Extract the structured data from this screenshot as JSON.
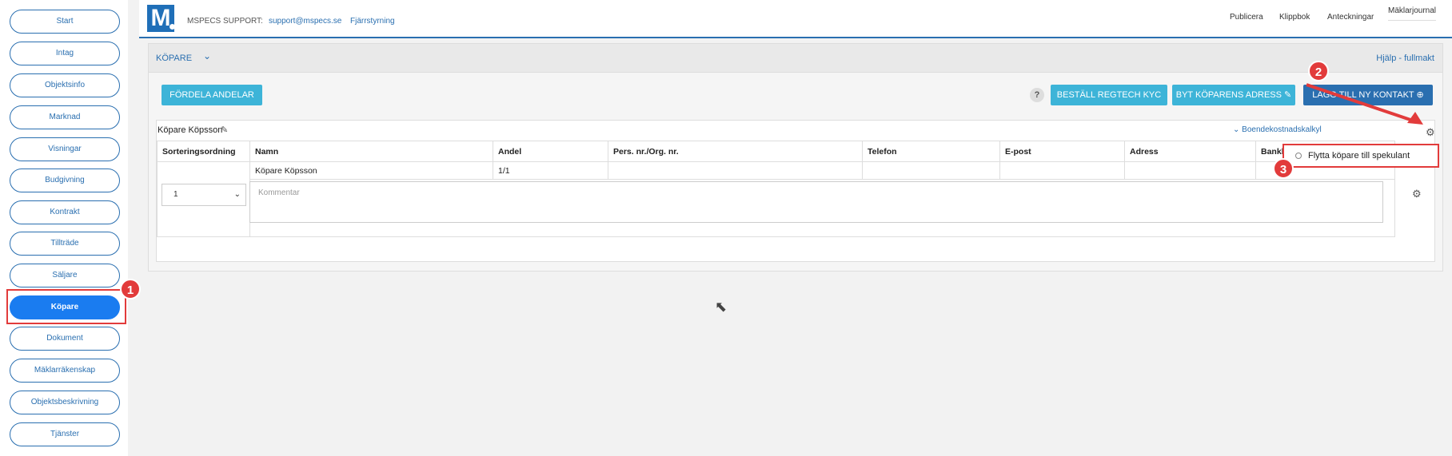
{
  "sidebar": {
    "items": [
      {
        "label": "Start"
      },
      {
        "label": "Intag"
      },
      {
        "label": "Objektsinfo"
      },
      {
        "label": "Marknad"
      },
      {
        "label": "Visningar"
      },
      {
        "label": "Budgivning"
      },
      {
        "label": "Kontrakt"
      },
      {
        "label": "Tillträde"
      },
      {
        "label": "Säljare"
      },
      {
        "label": "Köpare"
      },
      {
        "label": "Dokument"
      },
      {
        "label": "Mäklarräkenskap"
      },
      {
        "label": "Objektsbeskrivning"
      },
      {
        "label": "Tjänster"
      }
    ],
    "active": "Köpare"
  },
  "topbar": {
    "logo": "M",
    "support_label": "MSPECS SUPPORT:",
    "support_email": "support@mspecs.se",
    "remote": "Fjärrstyrning",
    "links": [
      "Publicera",
      "Klippbok",
      "Anteckningar",
      "Mäklarjournal"
    ]
  },
  "panel": {
    "title": "KÖPARE",
    "help": "Hjälp - fullmakt",
    "buttons": {
      "fordela": "FÖRDELA ANDELAR",
      "help_mark": "?",
      "regtech": "BESTÄLL REGTECH KYC",
      "byt_adress": "BYT KÖPARENS ADRESS ✎",
      "lagg_till": "LÄGG TILL NY KONTAKT ⊕"
    }
  },
  "buyer_card": {
    "title": "Köpare Köpsson",
    "boende_link": "Boendekostnadskalkyl",
    "columns": [
      "Sorteringsordning",
      "Namn",
      "Andel",
      "Pers. nr./Org. nr.",
      "Telefon",
      "E-post",
      "Adress",
      "Bankl"
    ],
    "row": {
      "namn": "Köpare Köpsson",
      "andel": "1/1",
      "pers_nr": "",
      "telefon": "",
      "epost": "",
      "adress": ""
    },
    "sort_value": "1",
    "comment_placeholder": "Kommentar"
  },
  "popup": {
    "label": "Flytta köpare till spekulant"
  },
  "annotations": {
    "badge1": "1",
    "badge2": "2",
    "badge3": "3"
  },
  "colors": {
    "accent": "#2a6fb0",
    "active": "#1a7cf0",
    "cyan": "#3db4d8",
    "highlight": "#e23b3b"
  }
}
